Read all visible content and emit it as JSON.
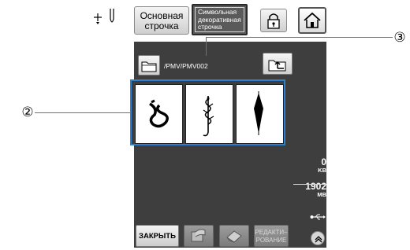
{
  "top_tabs": {
    "basic_line1": "Основная",
    "basic_line2": "строчка",
    "char_line1": "Символьная",
    "char_line2": "декоративная",
    "char_line3": "строчка"
  },
  "icons": {
    "needle": "needle-position-icon",
    "lock": "lock-icon",
    "home": "home-icon",
    "folder": "folder-icon",
    "up": "folder-up-icon",
    "usb": "usb-icon",
    "load": "load-icon",
    "erase": "eraser-icon",
    "expand": "chevron-up-icon"
  },
  "path": "/PMV/PMV002",
  "patterns": [
    {
      "name": "knot-pattern"
    },
    {
      "name": "leaf-stem-pattern"
    },
    {
      "name": "diamond-pattern"
    }
  ],
  "info": {
    "used_value": "0",
    "used_unit": "KB",
    "free_value": "1902",
    "free_unit": "MB"
  },
  "bottom": {
    "close_label": "ЗАКРЫТЬ",
    "edit_line1": "РЕДАКТИ–",
    "edit_line2": "РОВАНИЕ"
  },
  "callouts": {
    "grid": "②",
    "path": "③"
  },
  "colors": {
    "panel": "#3e3e3e",
    "selection": "#2f7fcf"
  }
}
